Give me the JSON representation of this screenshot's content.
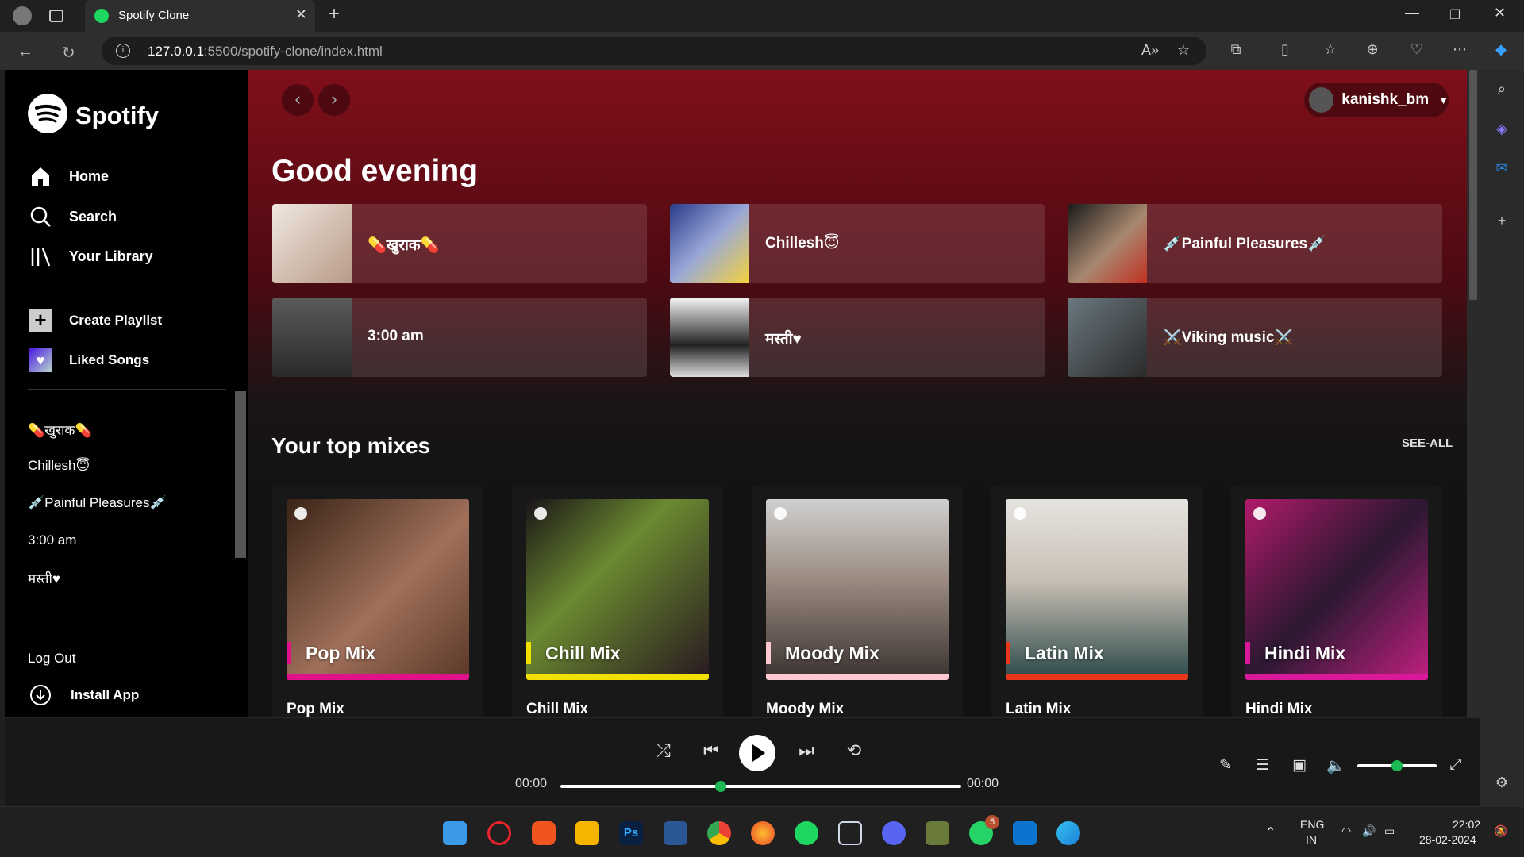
{
  "browser": {
    "tab_title": "Spotify Clone",
    "url_host": "127.0.0.1",
    "url_rest": ":5500/spotify-clone/index.html"
  },
  "sidebar": {
    "brand": "Spotify",
    "nav": [
      {
        "label": "Home",
        "icon": "home-icon"
      },
      {
        "label": "Search",
        "icon": "search-icon"
      },
      {
        "label": "Your Library",
        "icon": "library-icon"
      }
    ],
    "actions": [
      {
        "label": "Create Playlist",
        "icon": "plus-icon"
      },
      {
        "label": "Liked Songs",
        "icon": "heart-icon"
      }
    ],
    "playlists": [
      "💊खुराक💊",
      "Chillesh😇",
      "💉Painful Pleasures💉",
      "3:00 am",
      "मस्ती♥"
    ],
    "logout": "Log Out",
    "install": "Install App"
  },
  "header": {
    "username": "kanishk_bm"
  },
  "main": {
    "greeting": "Good evening",
    "quick": [
      {
        "label": "💊खुराक💊"
      },
      {
        "label": "Chillesh😇"
      },
      {
        "label": "💉Painful Pleasures💉"
      },
      {
        "label": "3:00 am"
      },
      {
        "label": "मस्ती♥"
      },
      {
        "label": "⚔️Viking music⚔️"
      }
    ],
    "section_title": "Your top mixes",
    "see_all": "SEE-ALL",
    "mixes": [
      {
        "cover_text": "Pop Mix",
        "title": "Pop Mix",
        "color": "#e1118c"
      },
      {
        "cover_text": "Chill Mix",
        "title": "Chill Mix",
        "color": "#f2e100"
      },
      {
        "cover_text": "Moody Mix",
        "title": "Moody Mix",
        "color": "#ffc8d0"
      },
      {
        "cover_text": "Latin Mix",
        "title": "Latin Mix",
        "color": "#e8371c"
      },
      {
        "cover_text": "Hindi Mix",
        "title": "Hindi Mix",
        "color": "#d9189a"
      }
    ]
  },
  "player": {
    "time_current": "00:00",
    "time_total": "00:00",
    "progress": 0.4,
    "volume": 0.5
  },
  "taskbar": {
    "lang": "ENG",
    "region": "IN",
    "time": "22:02",
    "date": "28-02-2024",
    "whatsapp_badge": "5"
  }
}
